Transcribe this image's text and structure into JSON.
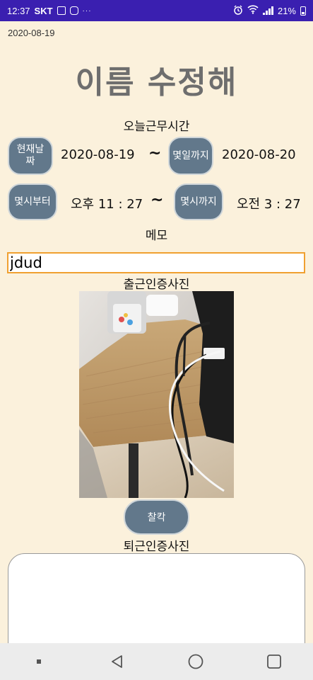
{
  "status_bar": {
    "time": "12:37",
    "carrier": "SKT",
    "overflow": "···",
    "battery_percent": "21%",
    "icons": [
      "picture-icon",
      "messenger-icon",
      "alarm-icon",
      "wifi-icon",
      "signal-icon",
      "battery-icon"
    ]
  },
  "header": {
    "current_date": "2020-08-19",
    "title": "이름 수정해",
    "subtitle": "오늘근무시간"
  },
  "schedule": {
    "date_row": {
      "start_button": "현재날짜",
      "start_value": "2020-08-19",
      "separator": "~",
      "end_button": "몇일까지",
      "end_value": "2020-08-20"
    },
    "time_row": {
      "start_button": "몇시부터",
      "start_value": "오후 11 : 27",
      "separator": "~",
      "end_button": "몇시까지",
      "end_value": "오전 3 : 27"
    }
  },
  "memo": {
    "label": "메모",
    "value": "jdud"
  },
  "check_in_photo": {
    "label": "출근인증사진"
  },
  "snap_button": "찰칵",
  "check_out_photo": {
    "label": "퇴근인증사진"
  },
  "colors": {
    "background": "#fbf1dc",
    "status_bar": "#3a1fb0",
    "button": "#62788b",
    "memo_border": "#f0a030"
  },
  "nav_bar": {
    "buttons": [
      "recent-apps-button",
      "back-button",
      "home-button",
      "overview-button"
    ]
  }
}
